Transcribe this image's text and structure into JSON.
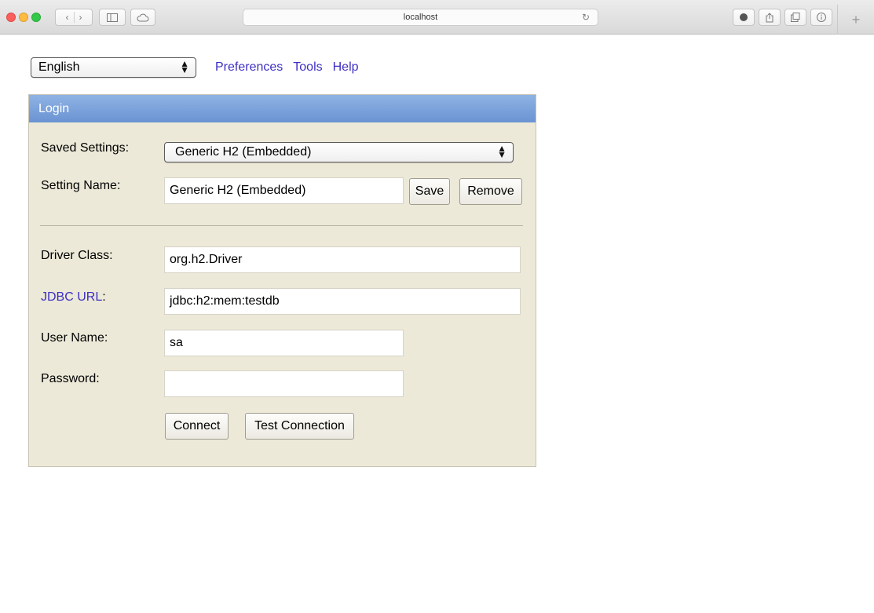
{
  "browser": {
    "address": "localhost",
    "icons": {
      "back": "chevron-left-icon",
      "forward": "chevron-right-icon",
      "sidebar": "sidebar-icon",
      "icloud": "cloud-icon",
      "reload": "reload-icon",
      "download": "download-icon",
      "share": "share-icon",
      "tabs": "tabs-icon",
      "info": "info-icon",
      "new_tab": "plus-icon"
    },
    "new_tab_label": "+"
  },
  "topbar": {
    "language": "English",
    "links": [
      "Preferences",
      "Tools",
      "Help"
    ]
  },
  "login": {
    "title": "Login",
    "saved_settings_label": "Saved Settings:",
    "saved_settings_value": "Generic H2 (Embedded)",
    "setting_name_label": "Setting Name:",
    "setting_name_value": "Generic H2 (Embedded)",
    "save_label": "Save",
    "remove_label": "Remove",
    "driver_class_label": "Driver Class:",
    "driver_class_value": "org.h2.Driver",
    "jdbc_url_label": "JDBC URL",
    "jdbc_url_colon": ":",
    "jdbc_url_value": "jdbc:h2:mem:testdb",
    "user_name_label": "User Name:",
    "user_name_value": "sa",
    "password_label": "Password:",
    "password_value": "",
    "connect_label": "Connect",
    "test_connection_label": "Test Connection"
  },
  "colors": {
    "link": "#3d2fc2",
    "panel_bg": "#ece9d8",
    "header_bg": "#7ea4dc"
  }
}
